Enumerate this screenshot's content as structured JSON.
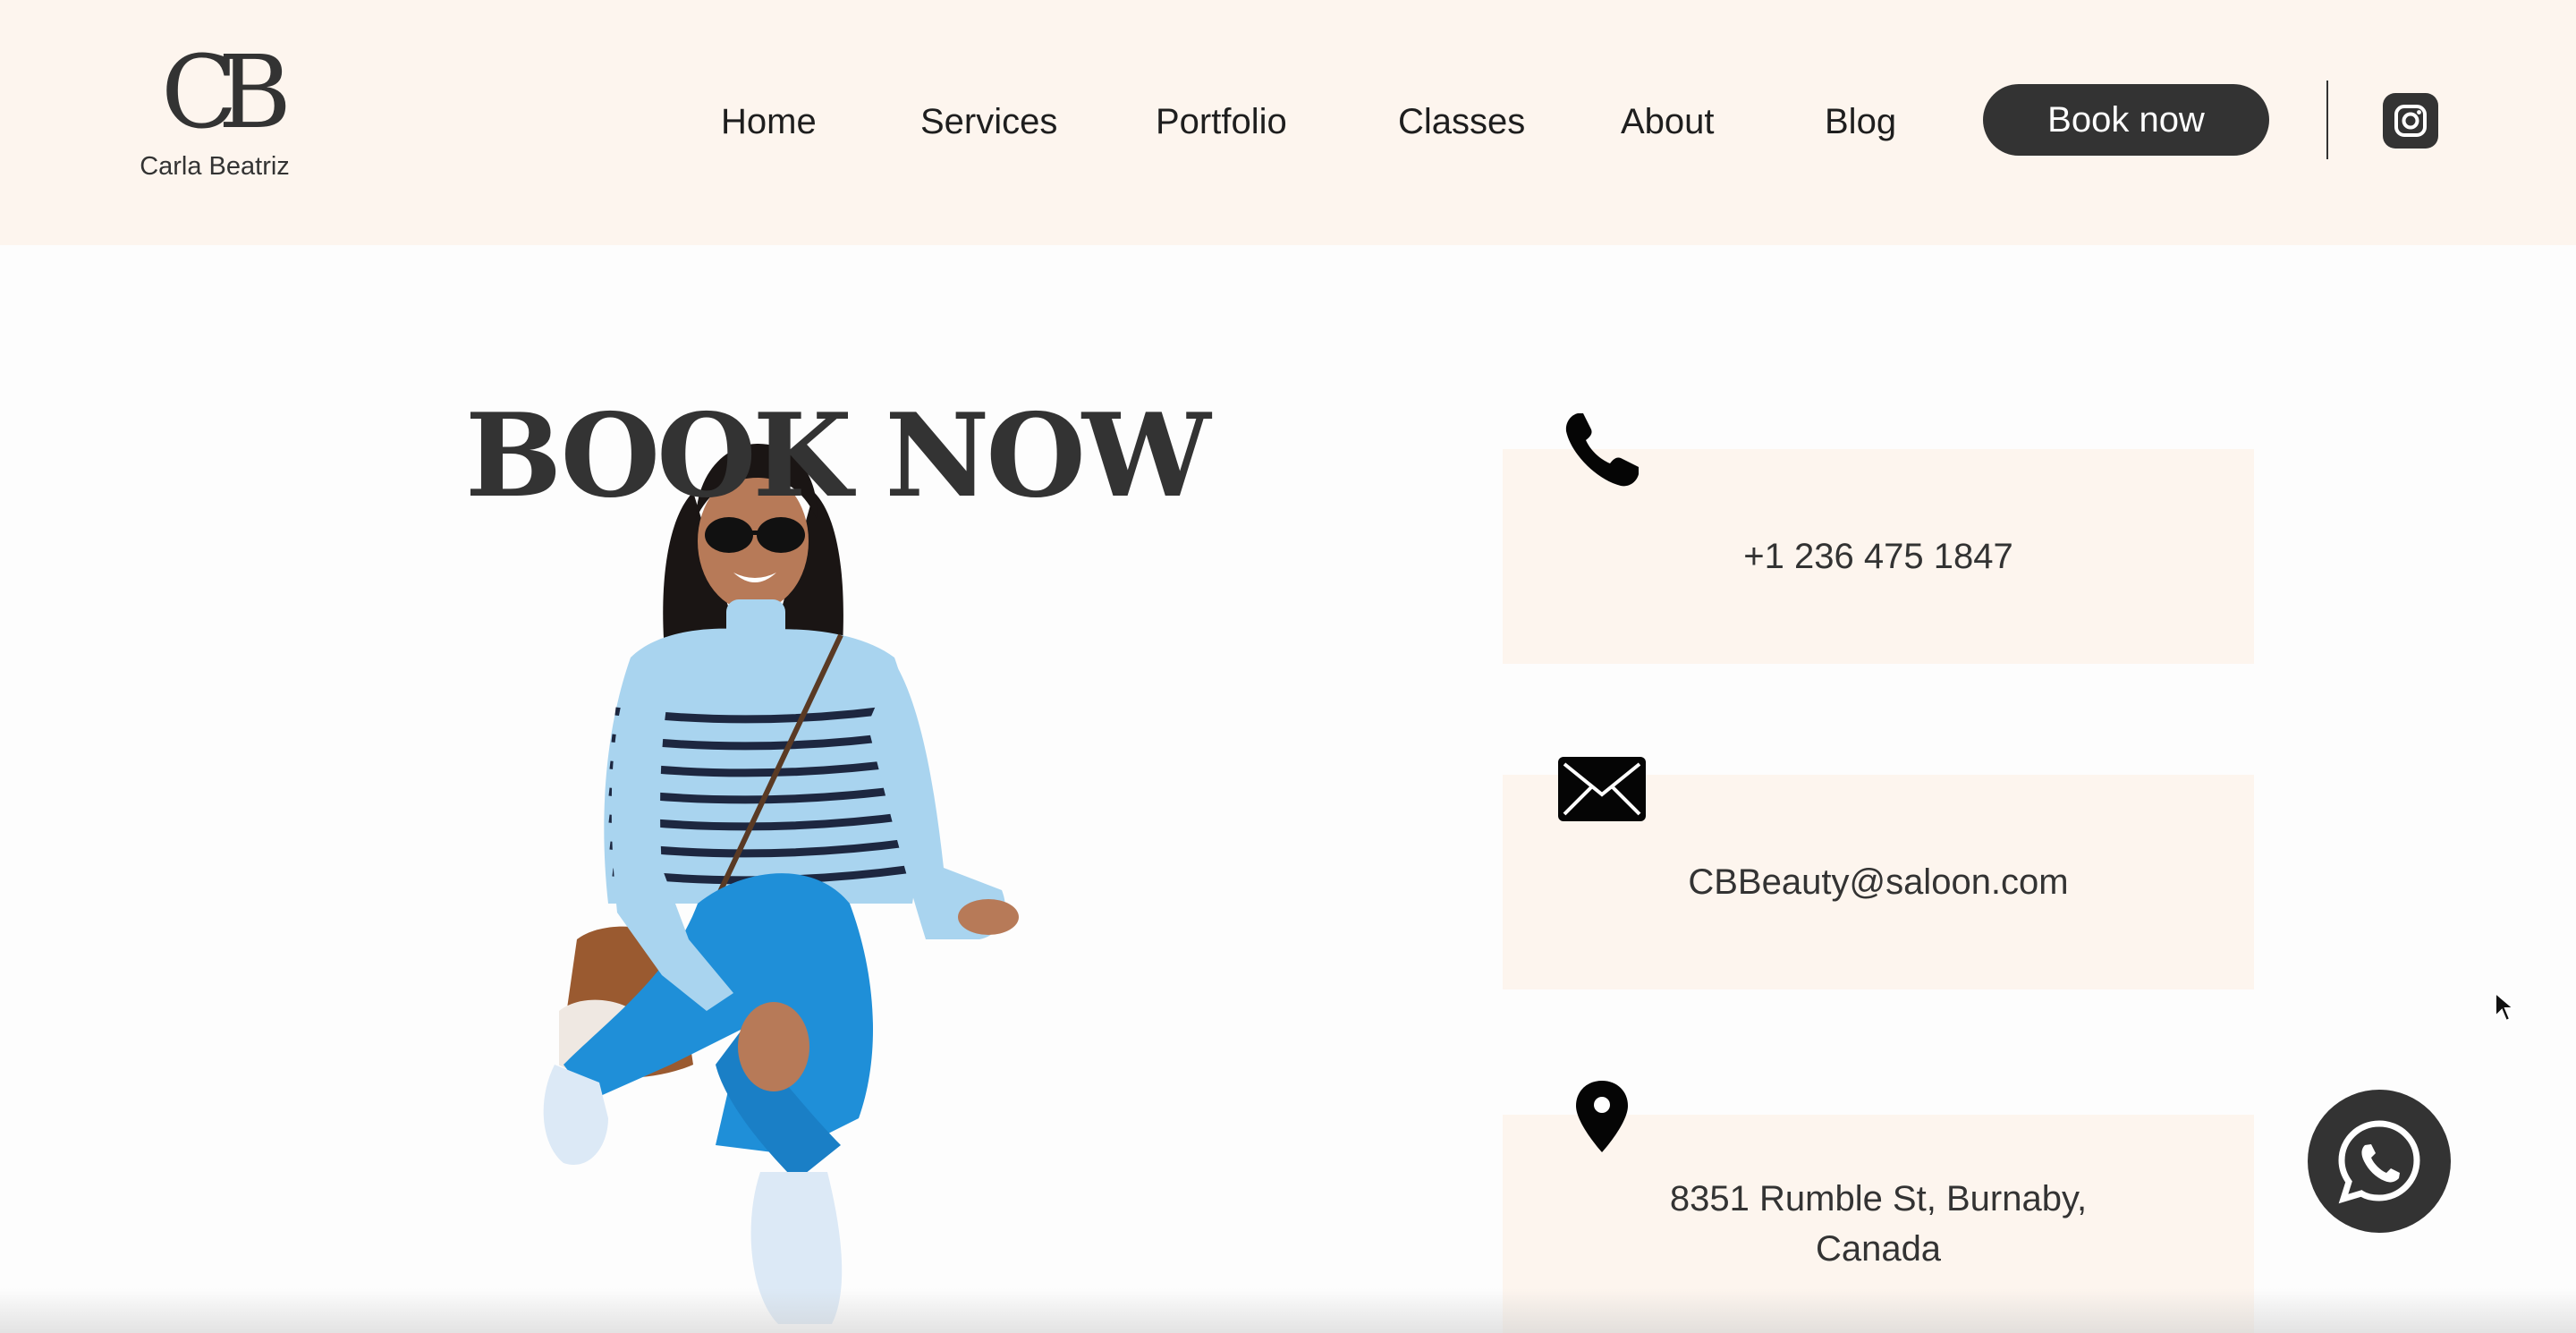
{
  "logo": {
    "mark": "CB",
    "name": "Carla Beatriz"
  },
  "nav": {
    "items": [
      {
        "label": "Home"
      },
      {
        "label": "Services"
      },
      {
        "label": "Portfolio"
      },
      {
        "label": "Classes"
      },
      {
        "label": "About"
      },
      {
        "label": "Blog"
      }
    ],
    "book_label": "Book now"
  },
  "hero": {
    "title": "BOOK NOW"
  },
  "contact": {
    "phone": "+1 236 475 1847",
    "email": "CBBeauty@saloon.com",
    "address_line1": "8351 Rumble St, Burnaby,",
    "address_line2": "Canada"
  },
  "colors": {
    "header_bg": "#fdf5ee",
    "card_bg": "#fdf5ee",
    "dark": "#333333",
    "page_bg": "#fdfdfd"
  },
  "icons": {
    "social": "instagram-icon",
    "phone": "phone-icon",
    "email": "envelope-icon",
    "address": "map-pin-icon",
    "chat": "whatsapp-icon"
  }
}
